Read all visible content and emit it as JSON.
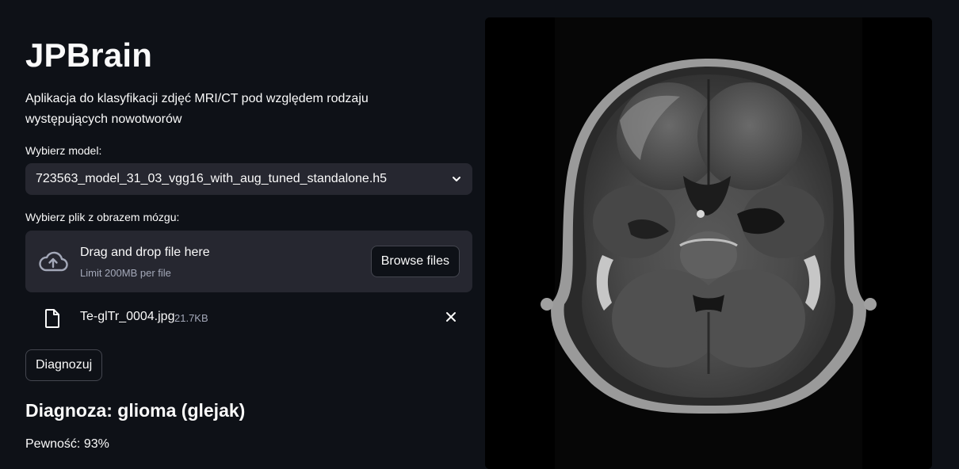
{
  "app": {
    "title": "JPBrain",
    "description": "Aplikacja do klasyfikacji zdjęć MRI/CT pod względem rodzaju występujących nowotworów"
  },
  "model_select": {
    "label": "Wybierz model:",
    "selected_value": "723563_model_31_03_vgg16_with_aug_tuned_standalone.h5",
    "icon": "chevron-down-icon"
  },
  "uploader": {
    "label": "Wybierz plik z obrazem mózgu:",
    "drop_title": "Drag and drop file here",
    "limit_text": "Limit 200MB per file",
    "browse_label": "Browse files",
    "icon": "cloud-upload-icon"
  },
  "uploaded_file": {
    "name": "Te-glTr_0004.jpg",
    "size": "21.7KB",
    "icon": "file-icon",
    "remove_icon": "close-icon"
  },
  "actions": {
    "diagnose_label": "Diagnozuj"
  },
  "result": {
    "heading": "Diagnoza: glioma (glejak)",
    "confidence_text": "Pewność: 93%"
  },
  "colors": {
    "background": "#0e1117",
    "widget_bg": "#262730",
    "text": "#fafafa",
    "muted_text": "#a3a8b8",
    "border": "#44464f"
  }
}
